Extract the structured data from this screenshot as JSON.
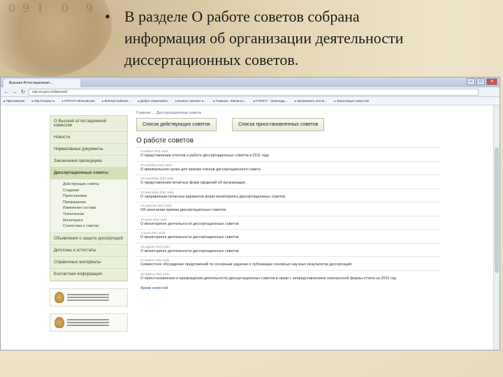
{
  "slide": {
    "bullet": "•",
    "lines": [
      "В разделе О работе советов собрана",
      "информация об организации деятельности",
      "диссертационных советов."
    ]
  },
  "background": {
    "numbers": "091 0 9"
  },
  "browser": {
    "tab_title": "Высшая Аттестационная...",
    "url": "vak.ed.gov.ru/dissovet/",
    "bookmarks": [
      "Приложения",
      "http://nauka.ru",
      "ГАРАНТ-Московская",
      "Личный кабинет...",
      "Добро пожаловать",
      "Бизнес-тренинг и...",
      "Главная - Финансо...",
      "ГАРАНТ - Законода...",
      "Запоминать после...",
      "Трансляция новостей"
    ]
  },
  "sidebar": {
    "items": [
      {
        "label": "О Высшей аттестационной комиссии"
      },
      {
        "label": "Новости"
      },
      {
        "label": "Нормативные документы"
      },
      {
        "label": "Заключения президиума"
      },
      {
        "label": "Диссертационные советы"
      }
    ],
    "subitems": [
      "Действующие советы",
      "Создание",
      "Приостановка",
      "Прекращение",
      "Изменение состава",
      "Техническая",
      "Мониторинг",
      "Статистика о советах"
    ],
    "items_after": [
      {
        "label": "Объявления о защите диссертаций"
      },
      {
        "label": "Дипломы и аттестаты"
      },
      {
        "label": "Справочные материалы"
      },
      {
        "label": "Контактная информация"
      }
    ]
  },
  "main": {
    "breadcrumb": "Главная → Диссертационные советы",
    "tabs": [
      "Список действующих советов",
      "Список приостановленных советов"
    ],
    "tab_separator": "·",
    "title": "О работе советов",
    "news": [
      {
        "date": "3 ноября 2011 года",
        "title": "О представлении отчетов о работе диссертационных советов в 2011 году"
      },
      {
        "date": "27 октября 2011 года",
        "title": "О минимальном сроке для приема членов диссертационного совета"
      },
      {
        "date": "19 сентября 2011 года",
        "title": "О представлении печатных форм сведений об организации"
      },
      {
        "date": "15 сентября 2011 года",
        "title": "О направлении печатных вариантов форм мониторинга диссертационных советов"
      },
      {
        "date": "15 августа 2011 года",
        "title": "Об окончании приема диссертационных советов"
      },
      {
        "date": "15 июля 2011 года",
        "title": "О мониторинге деятельности диссертационных советов"
      },
      {
        "date": "1 июля 2011 года",
        "title": "О мониторинге деятельности диссертационных советов"
      },
      {
        "date": "15 апреля 2011 года",
        "title": "О мониторинге деятельности диссертационных советов"
      },
      {
        "date": "31 марта 2011 года",
        "title": "Совместное обсуждение предложений по основным задачам о публикации основных научных результатов диссертаций"
      },
      {
        "date": "30 марта 2011 года",
        "title": "О приостановлении и прекращении деятельности диссертационных советов в связи с непредставлением электронной формы отчета за 2010 год"
      }
    ],
    "archive_link": "Архив новостей"
  }
}
